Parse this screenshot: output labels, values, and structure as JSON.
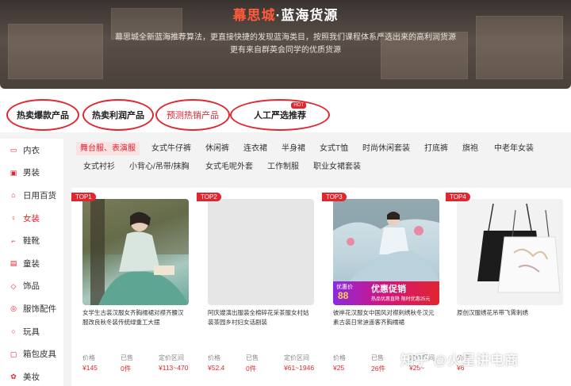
{
  "banner": {
    "title_brand": "幕思城",
    "title_rest": "·蓝海货源",
    "subtitle_line1": "幕思城全新蓝海推荐算法，更直接快捷的发现蓝海类目，按照我们课程体系严选出来的高利润货源",
    "subtitle_line2": "更有来自群英会同学的优质货源"
  },
  "top_tabs": [
    {
      "label": "热卖爆款产品"
    },
    {
      "label": "热卖利润产品"
    },
    {
      "label": "预测热销产品"
    },
    {
      "label": "人工严选推荐",
      "badge": "HOT"
    }
  ],
  "sidebar": {
    "items": [
      {
        "icon": "underwear-icon",
        "label": "内衣"
      },
      {
        "icon": "menswear-icon",
        "label": "男装"
      },
      {
        "icon": "daily-goods-icon",
        "label": "日用百货"
      },
      {
        "icon": "womenswear-icon",
        "label": "女装"
      },
      {
        "icon": "shoes-icon",
        "label": "鞋靴"
      },
      {
        "icon": "kidswear-icon",
        "label": "童装"
      },
      {
        "icon": "jewelry-icon",
        "label": "饰品"
      },
      {
        "icon": "accessory-icon",
        "label": "服饰配件"
      },
      {
        "icon": "toy-icon",
        "label": "玩具"
      },
      {
        "icon": "luggage-icon",
        "label": "箱包皮具"
      },
      {
        "icon": "beauty-icon",
        "label": "美妆"
      }
    ]
  },
  "filters": {
    "row1": [
      "舞台服、表演服",
      "女式牛仔裤",
      "休闲裤",
      "连衣裙",
      "半身裙",
      "女式T恤",
      "时尚休闲套装",
      "打底裤",
      "旗袍",
      "中老年女装"
    ],
    "row2": [
      "女式衬衫",
      "小背心/吊带/抹胸",
      "女式毛呢外套",
      "工作制服",
      "职业女裙套装"
    ]
  },
  "stat_labels": {
    "price": "价格",
    "sold": "已售",
    "range": "定价区间"
  },
  "products": [
    {
      "rank": "TOP1",
      "title": "女学生古装汉服女齐胸襦裙对襟齐腰汉服改良秋冬装传统绿重工大摆",
      "price": "¥145",
      "sold": "0件",
      "range": "¥113~470"
    },
    {
      "rank": "TOP2",
      "title": "阿庆嫂演出服装全棉碎花采茶服女村姑装茶园乡村妇女话剧装",
      "price": "¥52.4",
      "sold": "0件",
      "range": "¥61~1946"
    },
    {
      "rank": "TOP3",
      "title": "彼岸花汉服女中国风对襟刺绣秋冬汉元素古装日常迪遥客齐胸襦裙",
      "price": "¥25",
      "sold": "26件",
      "range": "¥25~",
      "promo": {
        "tag": "优惠价",
        "price": "88",
        "headline": "优惠促销",
        "note1": "热品优惠直降",
        "note2": "限时优惠25元"
      }
    },
    {
      "rank": "TOP4",
      "title": "原创汉服绣花吊带飞霄刺绣",
      "price": "¥6",
      "sold": "",
      "range": ""
    }
  ],
  "watermark": "知乎 @火星讲电商"
}
